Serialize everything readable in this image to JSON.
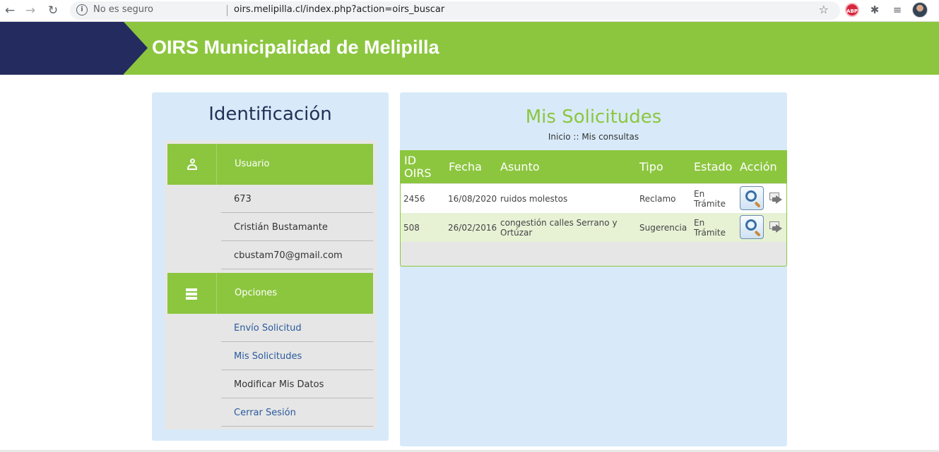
{
  "browser": {
    "security_label": "No es seguro",
    "url": "oirs.melipilla.cl/index.php?action=oirs_buscar",
    "back_glyph": "←",
    "forward_glyph": "→",
    "reload_glyph": "↻",
    "star_glyph": "☆",
    "extension_abp": "ABP",
    "extension_puzzle_glyph": "✱",
    "media_glyph": "≡"
  },
  "header": {
    "title": "OIRS Municipalidad de Melipilla",
    "colors": {
      "green": "#8cc63f",
      "navy": "#232b5f"
    }
  },
  "identificacion": {
    "title": "Identificación",
    "usuario_label": "Usuario",
    "user_id": "673",
    "user_name": "Cristián Bustamante",
    "user_email": "cbustam70@gmail.com",
    "opciones_label": "Opciones",
    "options": [
      {
        "label": "Envío Solicitud"
      },
      {
        "label": "Mis Solicitudes"
      },
      {
        "label": "Modificar Mis Datos"
      },
      {
        "label": "Cerrar Sesión"
      }
    ]
  },
  "solicitudes": {
    "title": "Mis Solicitudes",
    "breadcrumb": "Inicio :: Mis consultas",
    "columns": {
      "id_line1": "ID",
      "id_line2": "OIRS",
      "fecha": "Fecha",
      "asunto": "Asunto",
      "tipo": "Tipo",
      "estado": "Estado",
      "accion": "Acción"
    },
    "rows": [
      {
        "id": "2456",
        "fecha": "16/08/2020",
        "asunto": "ruidos molestos",
        "tipo": "Reclamo",
        "estado_l1": "En",
        "estado_l2": "Trámite"
      },
      {
        "id": "508",
        "fecha": "26/02/2016",
        "asunto_l1": "congestión calles Serrano y",
        "asunto_l2": "Ortúzar",
        "tipo": "Sugerencia",
        "estado_l1": "En",
        "estado_l2": "Trámite"
      }
    ]
  }
}
